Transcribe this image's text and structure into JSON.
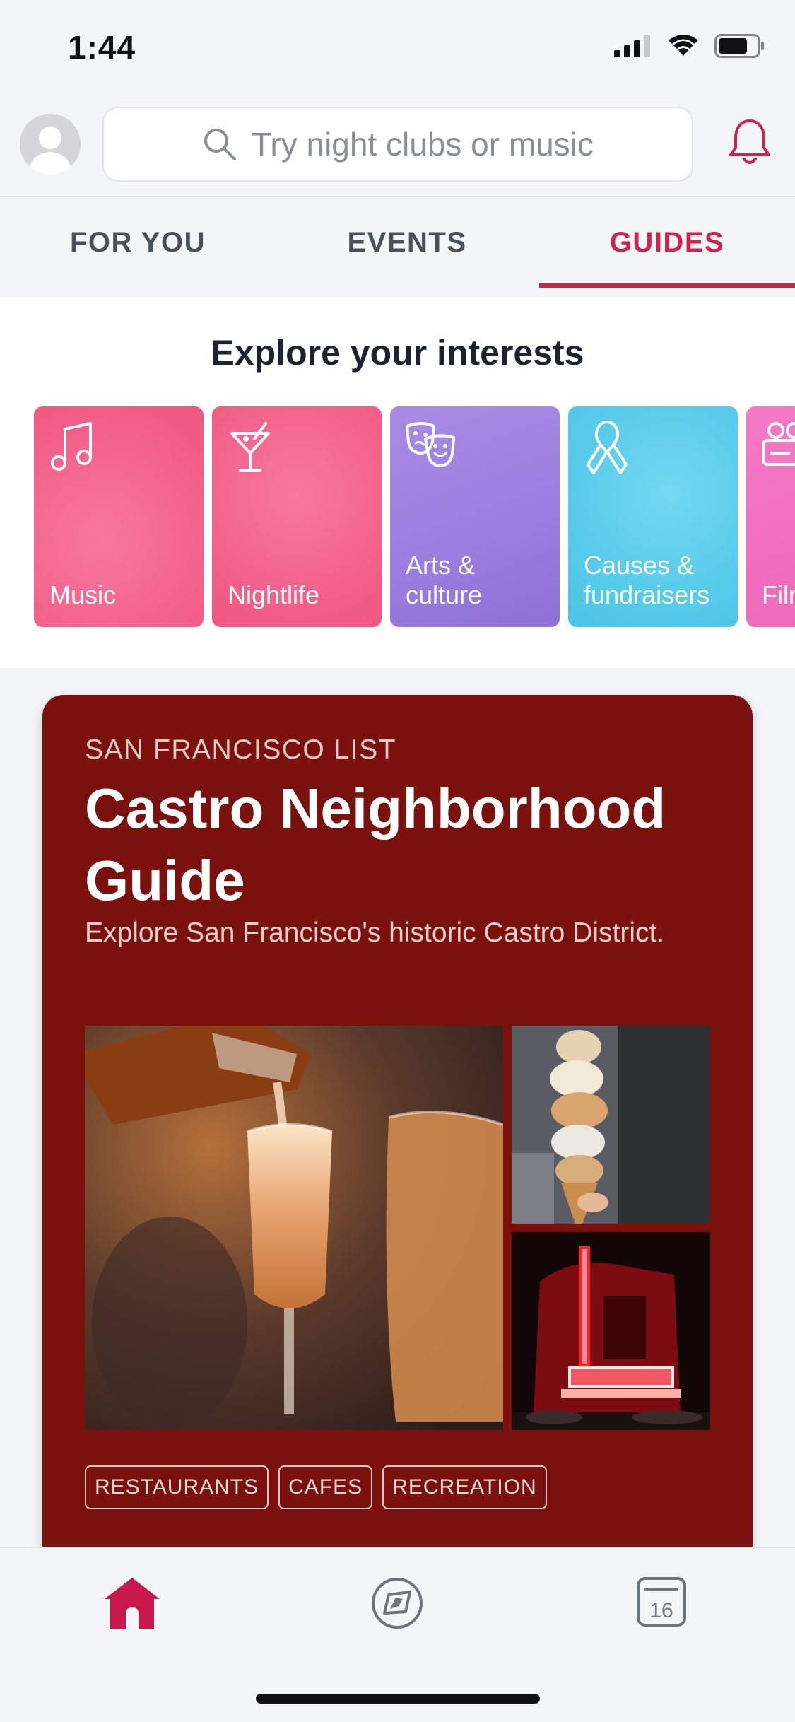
{
  "status": {
    "time": "1:44"
  },
  "header": {
    "search_placeholder": "Try night clubs or music"
  },
  "tabs": [
    {
      "label": "FOR YOU",
      "active": false
    },
    {
      "label": "EVENTS",
      "active": false
    },
    {
      "label": "GUIDES",
      "active": true
    }
  ],
  "interests": {
    "title": "Explore your interests",
    "items": [
      {
        "label": "Music",
        "icon": "music-note-icon",
        "color": "#f46a92"
      },
      {
        "label": "Nightlife",
        "icon": "cocktail-icon",
        "color": "#f46a92"
      },
      {
        "label": "Arts & culture",
        "icon": "theater-masks-icon",
        "color": "#9d7fe0"
      },
      {
        "label": "Causes & fundraisers",
        "icon": "ribbon-icon",
        "color": "#56cde8"
      },
      {
        "label": "Film",
        "icon": "camera-icon",
        "color": "#f06fbe"
      }
    ]
  },
  "guide": {
    "kicker": "SAN FRANCISCO LIST",
    "title": "Castro Neighborhood Guide",
    "description": "Explore San Francisco's historic Castro District.",
    "background": "#7b110c",
    "photos": [
      {
        "icon": "champagne-photo"
      },
      {
        "icon": "ice-cream-photo"
      },
      {
        "icon": "castro-theatre-photo"
      }
    ],
    "tags": [
      "RESTAURANTS",
      "CAFES",
      "RECREATION"
    ]
  },
  "tabbar": {
    "items": [
      {
        "icon": "home-icon",
        "active": true
      },
      {
        "icon": "compass-icon",
        "active": false
      },
      {
        "icon": "calendar-icon",
        "label": "16",
        "active": false
      }
    ]
  },
  "colors": {
    "accent": "#d1214d"
  }
}
